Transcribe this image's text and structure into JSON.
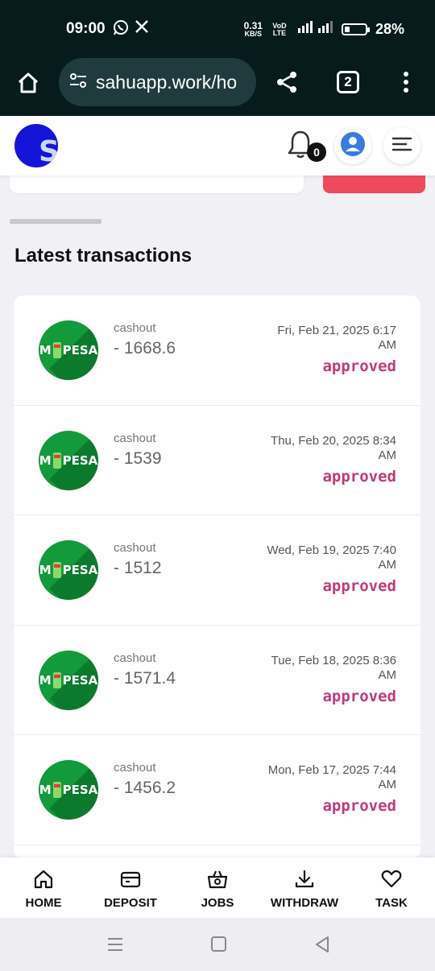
{
  "status_bar": {
    "time": "09:00",
    "net_speed_value": "0.31",
    "net_speed_unit": "KB/S",
    "carrier": "VoD LTE",
    "battery": "28%",
    "icons": [
      "whatsapp-icon",
      "x-icon",
      "signal-icon",
      "battery-icon"
    ]
  },
  "browser": {
    "url": "sahuapp.work/ho",
    "tab_count": "2"
  },
  "header": {
    "logo_letter": "S",
    "notification_count": "0"
  },
  "section": {
    "title": "Latest transactions"
  },
  "transactions": [
    {
      "type": "cashout",
      "amount": "- 1668.6",
      "date": "Fri, Feb 21, 2025 6:17 AM",
      "status": "approved",
      "logo": "M PESA"
    },
    {
      "type": "cashout",
      "amount": "- 1539",
      "date": "Thu, Feb 20, 2025 8:34 AM",
      "status": "approved",
      "logo": "M PESA"
    },
    {
      "type": "cashout",
      "amount": "- 1512",
      "date": "Wed, Feb 19, 2025 7:40 AM",
      "status": "approved",
      "logo": "M PESA"
    },
    {
      "type": "cashout",
      "amount": "- 1571.4",
      "date": "Tue, Feb 18, 2025 8:36 AM",
      "status": "approved",
      "logo": "M PESA"
    },
    {
      "type": "cashout",
      "amount": "- 1456.2",
      "date": "Mon, Feb 17, 2025 7:44 AM",
      "status": "approved",
      "logo": "M PESA"
    }
  ],
  "bottom_nav": [
    {
      "label": "HOME",
      "icon": "home-icon"
    },
    {
      "label": "DEPOSIT",
      "icon": "wallet-icon"
    },
    {
      "label": "JOBS",
      "icon": "basket-icon"
    },
    {
      "label": "WITHDRAW",
      "icon": "download-icon"
    },
    {
      "label": "TASK",
      "icon": "heart-icon"
    }
  ],
  "colors": {
    "status_approved": "#c23a7a",
    "mpesa_green": "#139a3a",
    "accent_red": "#ee4a5c",
    "logo_blue": "#1414d8"
  }
}
